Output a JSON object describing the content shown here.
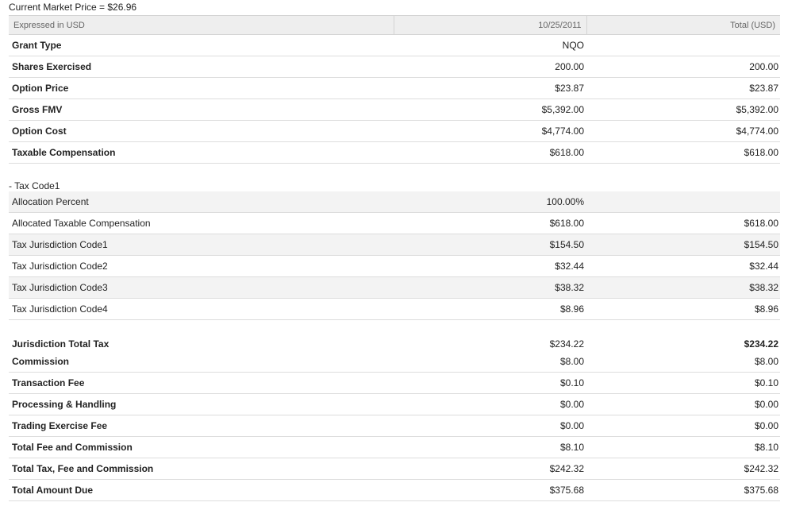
{
  "market_price": "Current Market Price = $26.96",
  "header": {
    "col1": "Expressed in USD",
    "col2": "10/25/2011",
    "col3": "Total (USD)"
  },
  "rows_top": [
    {
      "label": "Grant Type",
      "v1": "NQO",
      "v2": ""
    },
    {
      "label": "Shares Exercised",
      "v1": "200.00",
      "v2": "200.00"
    },
    {
      "label": "Option Price",
      "v1": "$23.87",
      "v2": "$23.87"
    },
    {
      "label": "Gross FMV",
      "v1": "$5,392.00",
      "v2": "$5,392.00"
    },
    {
      "label": "Option Cost",
      "v1": "$4,774.00",
      "v2": "$4,774.00"
    },
    {
      "label": "Taxable Compensation",
      "v1": "$618.00",
      "v2": "$618.00"
    }
  ],
  "tax_section": {
    "title": "- Tax Code1",
    "rows": [
      {
        "label": "Allocation Percent",
        "v1": "100.00%",
        "v2": ""
      },
      {
        "label": "Allocated Taxable Compensation",
        "v1": "$618.00",
        "v2": "$618.00"
      },
      {
        "label": "Tax Jurisdiction Code1",
        "v1": "$154.50",
        "v2": "$154.50"
      },
      {
        "label": "Tax Jurisdiction Code2",
        "v1": "$32.44",
        "v2": "$32.44"
      },
      {
        "label": "Tax Jurisdiction Code3",
        "v1": "$38.32",
        "v2": "$38.32"
      },
      {
        "label": "Tax Jurisdiction Code4",
        "v1": "$8.96",
        "v2": "$8.96"
      }
    ]
  },
  "rows_bottom": [
    {
      "label": "Jurisdiction Total Tax",
      "v1": "$234.22",
      "v2": "$234.22"
    },
    {
      "label": "Commission",
      "v1": "$8.00",
      "v2": "$8.00"
    },
    {
      "label": "Transaction Fee",
      "v1": "$0.10",
      "v2": "$0.10"
    },
    {
      "label": "Processing & Handling",
      "v1": "$0.00",
      "v2": "$0.00"
    },
    {
      "label": "Trading Exercise Fee",
      "v1": "$0.00",
      "v2": "$0.00"
    },
    {
      "label": "Total Fee and Commission",
      "v1": "$8.10",
      "v2": "$8.10"
    },
    {
      "label": "Total Tax, Fee and Commission",
      "v1": "$242.32",
      "v2": "$242.32"
    },
    {
      "label": "Total Amount Due",
      "v1": "$375.68",
      "v2": "$375.68"
    }
  ]
}
